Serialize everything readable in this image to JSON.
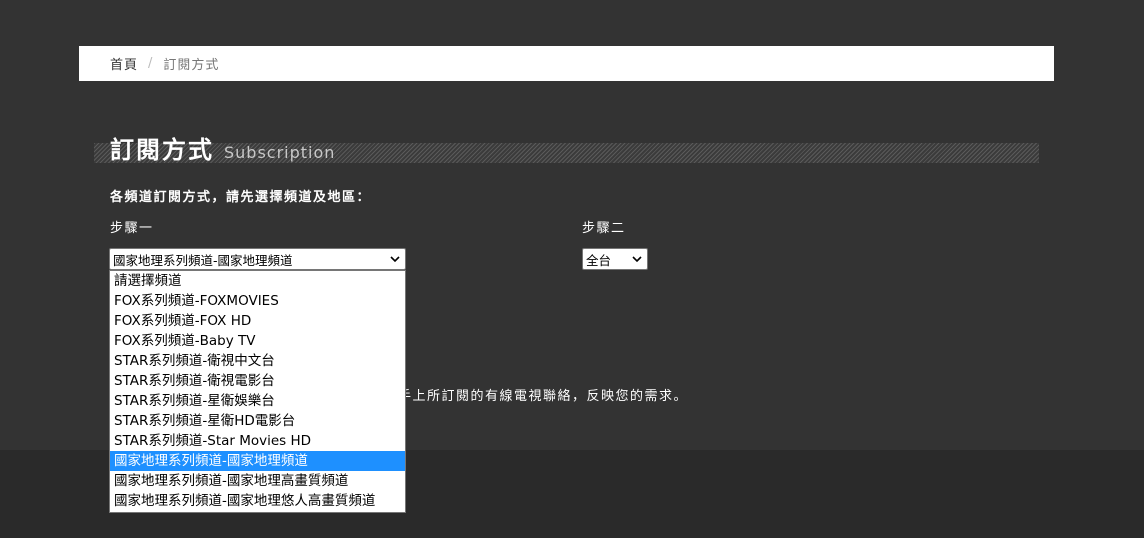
{
  "breadcrumb": {
    "home": "首頁",
    "separator": "/",
    "current": "訂閱方式"
  },
  "page": {
    "title": "訂閱方式",
    "subtitle": "Subscription",
    "intro": "各頻道訂閱方式，請先選擇頻道及地區："
  },
  "steps": {
    "step1_label": "步驟一",
    "step2_label": "步驟二"
  },
  "channel_select": {
    "value": "國家地理系列頻道-國家地理頻道",
    "options": [
      "請選擇頻道",
      "FOX系列頻道-FOXMOVIES",
      "FOX系列頻道-FOX HD",
      "FOX系列頻道-Baby TV",
      "STAR系列頻道-衛視中文台",
      "STAR系列頻道-衛視電影台",
      "STAR系列頻道-星衛娛樂台",
      "STAR系列頻道-星衛HD電影台",
      "STAR系列頻道-Star Movies HD",
      "國家地理系列頻道-國家地理頻道",
      "國家地理系列頻道-國家地理高畫質頻道",
      "國家地理系列頻道-國家地理悠人高畫質頻道"
    ],
    "selected_index": 9
  },
  "region_select": {
    "value": "全台"
  },
  "note": "手上所訂閱的有線電視聯絡，反映您的需求。",
  "colors": {
    "background": "#333333",
    "highlight": "#1e90ff"
  },
  "icons": {
    "dropdown": "chevron-down-icon"
  }
}
